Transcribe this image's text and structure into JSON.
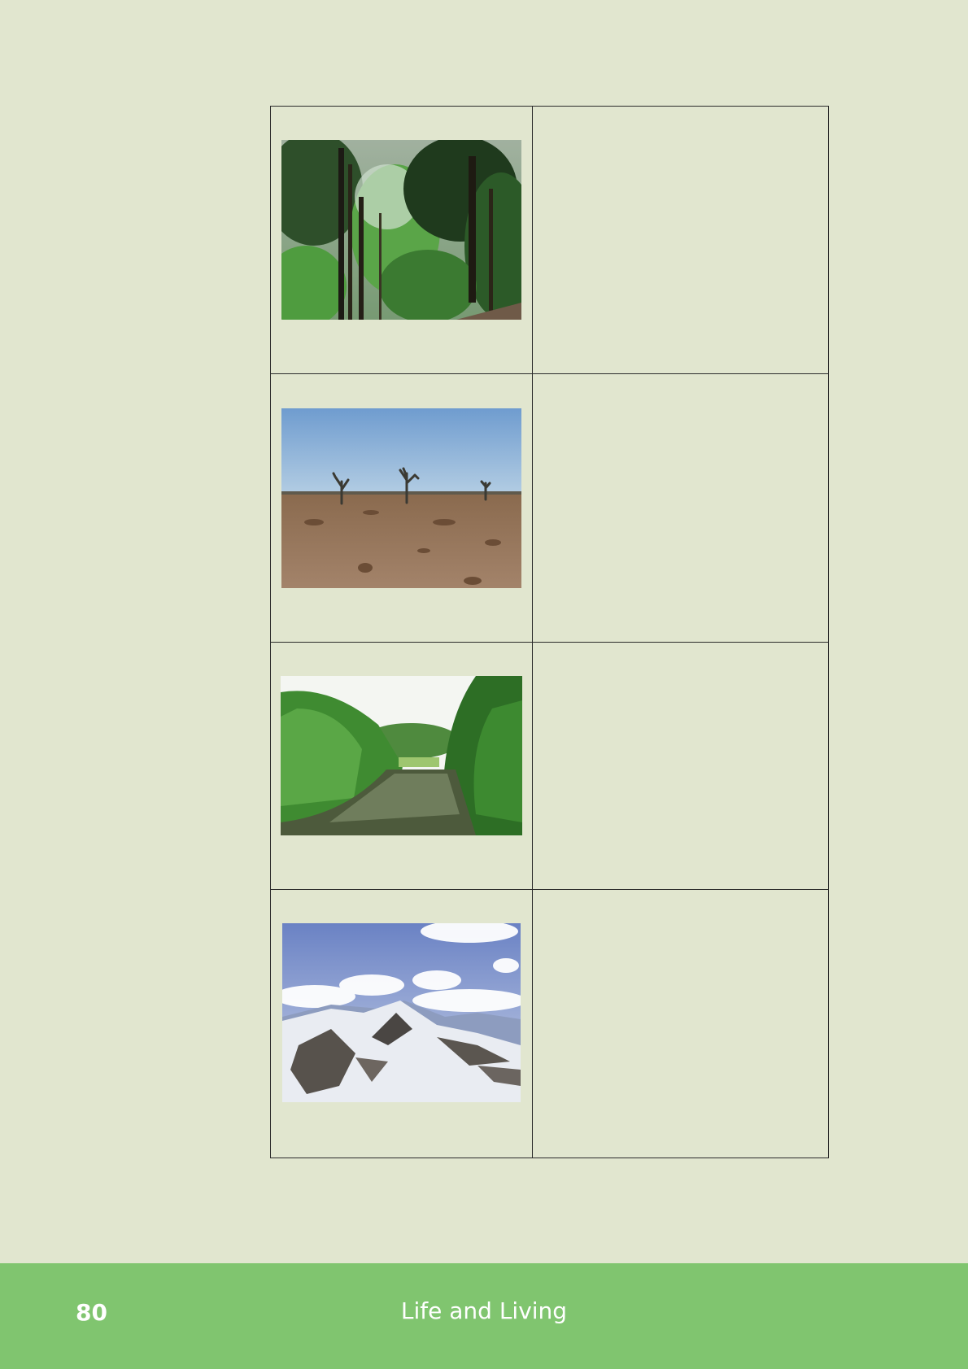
{
  "photos": [
    {
      "icon": "forest-photo",
      "subject": "forest"
    },
    {
      "icon": "desert-photo",
      "subject": "desert"
    },
    {
      "icon": "river-photo",
      "subject": "river"
    },
    {
      "icon": "snowy-mountains-photo",
      "subject": "snowy mountains"
    }
  ],
  "footer": {
    "page_number": "80",
    "book_title": "Life and Living",
    "color": "#80c56f"
  },
  "colors": {
    "page_background": "#e1e6cf",
    "table_border": "#2b2b2b"
  }
}
